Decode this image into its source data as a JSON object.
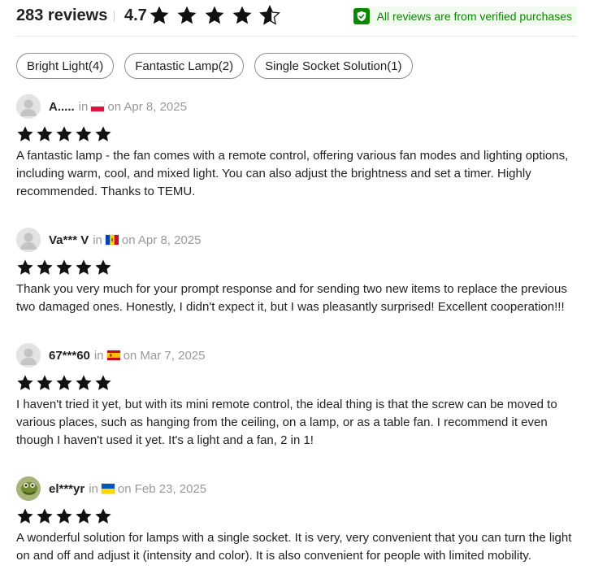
{
  "header": {
    "review_count": "283 reviews",
    "average_rating": "4.7",
    "rating_value": 4.7,
    "verified_text": "All reviews are from verified purchases"
  },
  "tags": [
    {
      "label": "Bright Light(4)"
    },
    {
      "label": "Fantastic Lamp(2)"
    },
    {
      "label": "Single Socket Solution(1)"
    }
  ],
  "reviews": [
    {
      "username": "A.....",
      "in_label": "in",
      "flag": "poland-flag",
      "date": "on Apr 8, 2025",
      "stars": 5,
      "text": "A fantastic lamp - the fan comes with a remote control, offering various fan modes and lighting options, including warm, cool, and mixed light. You can also adjust the brightness and set a timer. Highly recommended. Thanks to TEMU."
    },
    {
      "username": "Va*** V",
      "in_label": "in",
      "flag": "moldova-flag",
      "date": "on Apr 8, 2025",
      "stars": 5,
      "text": "Thank you very much for your prompt response and for sending two new items to replace the previous two damaged ones. Honestly, I didn't expect it, but I was pleasantly surprised! Excellent cooperation!!!"
    },
    {
      "username": "67***60",
      "in_label": "in",
      "flag": "spain-flag",
      "date": "on Mar 7, 2025",
      "stars": 5,
      "text": "I haven't tried it yet, but with its mini remote control, the ideal thing is that the screw can be moved to various places, such as hanging from the ceiling, on a lamp, or as a table fan. I recommend it even though I haven't used it yet. It's a light and a fan, 2 in 1!"
    },
    {
      "username": "el***yr",
      "in_label": "in",
      "flag": "ukraine-flag",
      "date": "on Feb 23, 2025",
      "stars": 5,
      "text": "A wonderful solution for lamps with a single socket. It is very, very convenient that you can turn the light on and off and adjust it (intensity and color). It is also convenient for people with limited mobility."
    }
  ],
  "colors": {
    "star": "#111111",
    "verified_green": "#0a8800",
    "verified_bg": "#f2f9ee",
    "meta_gray": "#999999"
  }
}
